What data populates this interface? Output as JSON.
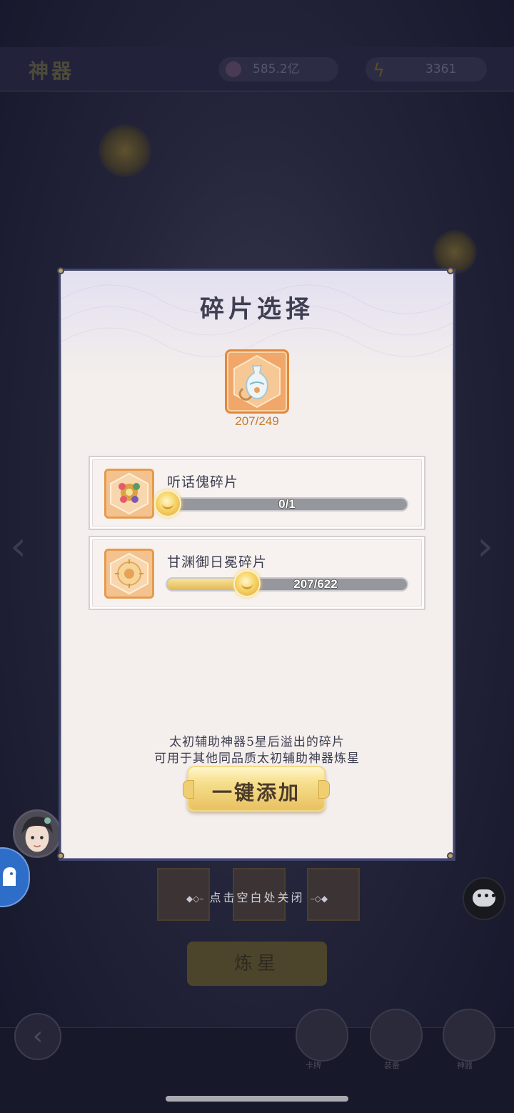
{
  "background": {
    "header_title": "神器",
    "currency_1": "585.2亿",
    "currency_2": "3361",
    "bottom_nav": [
      "卡牌",
      "装备",
      "神器"
    ]
  },
  "modal": {
    "title": "碎片选择",
    "main_fragment": {
      "icon": "artifact-vase-icon",
      "count": "207/249",
      "current": 207,
      "required": 249
    },
    "fragments": [
      {
        "name": "听话傀碎片",
        "icon": "puppet-fragment-icon",
        "progress_text": "0/1",
        "current": 0,
        "max": 1
      },
      {
        "name": "甘渊御日冕碎片",
        "icon": "sun-crown-fragment-icon",
        "progress_text": "207/622",
        "current": 207,
        "max": 622
      }
    ],
    "note_line_1": "太初辅助神器5星后溢出的碎片",
    "note_line_2": "可用于其他同品质太初辅助神器炼星",
    "add_all_button": "一键添加",
    "close_hint": "点击空白处关闭"
  },
  "colors": {
    "panel_bg": "#f4eeec",
    "panel_border": "#41466a",
    "accent_gold": "#e9c160",
    "count_text": "#c27c2e"
  }
}
